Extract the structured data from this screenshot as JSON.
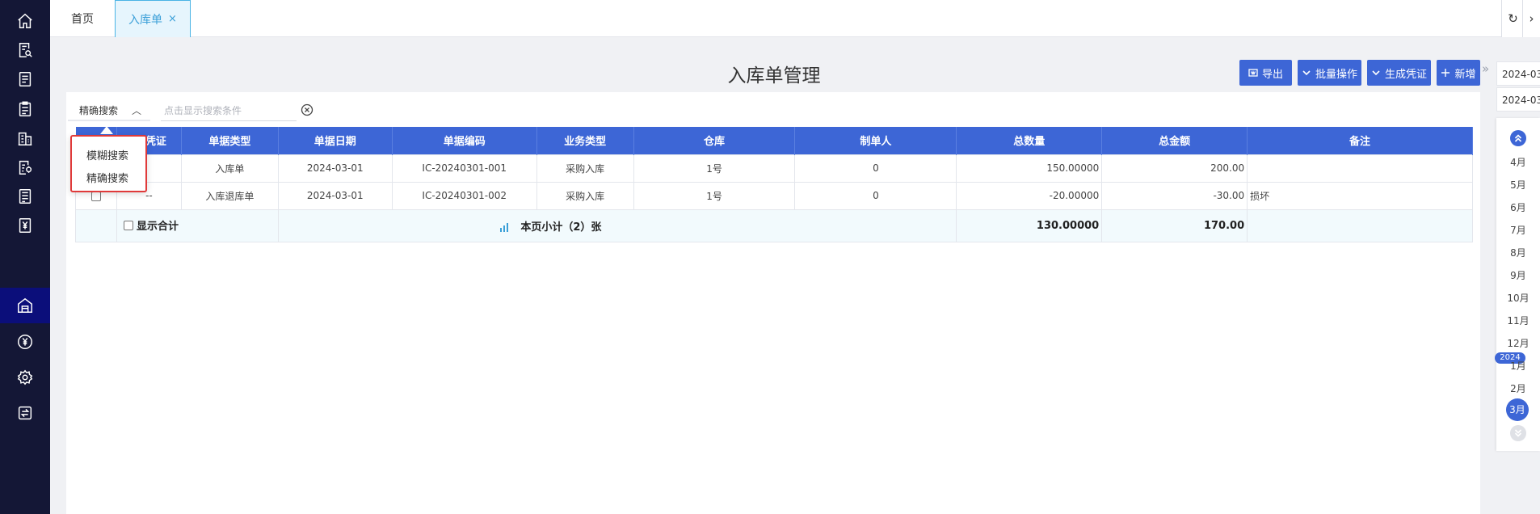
{
  "tabs": {
    "home": "首页",
    "active": "入库单",
    "close_glyph": "×"
  },
  "topbar_right": {
    "refresh_glyph": "↻",
    "more_glyph": "›"
  },
  "sidebar": {
    "icons": [
      "home-icon",
      "search-document-icon",
      "document-list-icon",
      "clipboard-icon",
      "building-icon",
      "document-settings-icon",
      "ledger-icon",
      "yen-document-icon",
      "warehouse-icon",
      "yen-circle-icon",
      "gear-icon",
      "transfer-icon"
    ],
    "active_index": 8
  },
  "page": {
    "title": "入库单管理"
  },
  "toolbar": {
    "export_label": "导出",
    "batch_label": "批量操作",
    "voucher_label": "生成凭证",
    "add_label": "新增"
  },
  "search": {
    "mode_label": "精确搜索",
    "placeholder": "点击显示搜索条件",
    "options": [
      "模糊搜索",
      "精确搜索"
    ]
  },
  "table": {
    "columns": [
      "",
      "凭证",
      "单据类型",
      "单据日期",
      "单据编码",
      "业务类型",
      "仓库",
      "制单人",
      "总数量",
      "总金额",
      "备注"
    ],
    "rows": [
      {
        "voucher": "",
        "doc_type": "入库单",
        "date": "2024-03-01",
        "code": "IC-20240301-001",
        "biz_type": "采购入库",
        "warehouse": "1号",
        "creator": "0",
        "qty": "150.00000",
        "amount": "200.00",
        "remark": ""
      },
      {
        "voucher": "--",
        "doc_type": "入库退库单",
        "date": "2024-03-01",
        "code": "IC-20240301-002",
        "biz_type": "采购入库",
        "warehouse": "1号",
        "creator": "0",
        "qty": "-20.00000",
        "amount": "-30.00",
        "remark": "损坏"
      }
    ],
    "total": {
      "show_label": "显示合计",
      "subtotal_label": "本页小计（2）张",
      "qty": "130.00000",
      "amount": "170.00"
    }
  },
  "date_filter": {
    "start": "2024-03",
    "end": "2024-03",
    "months_before": [
      "4月",
      "5月",
      "6月",
      "7月",
      "8月",
      "9月",
      "10月",
      "11月",
      "12月"
    ],
    "year_badge": "2024",
    "months_after": [
      "1月",
      "2月"
    ],
    "selected_month": "3月"
  },
  "colors": {
    "sidebar_bg": "#141736",
    "sidebar_active": "#0b0e7a",
    "primary": "#3d66d6",
    "tab_active_border": "#49b3e5",
    "dropdown_highlight": "#e03a3a"
  }
}
